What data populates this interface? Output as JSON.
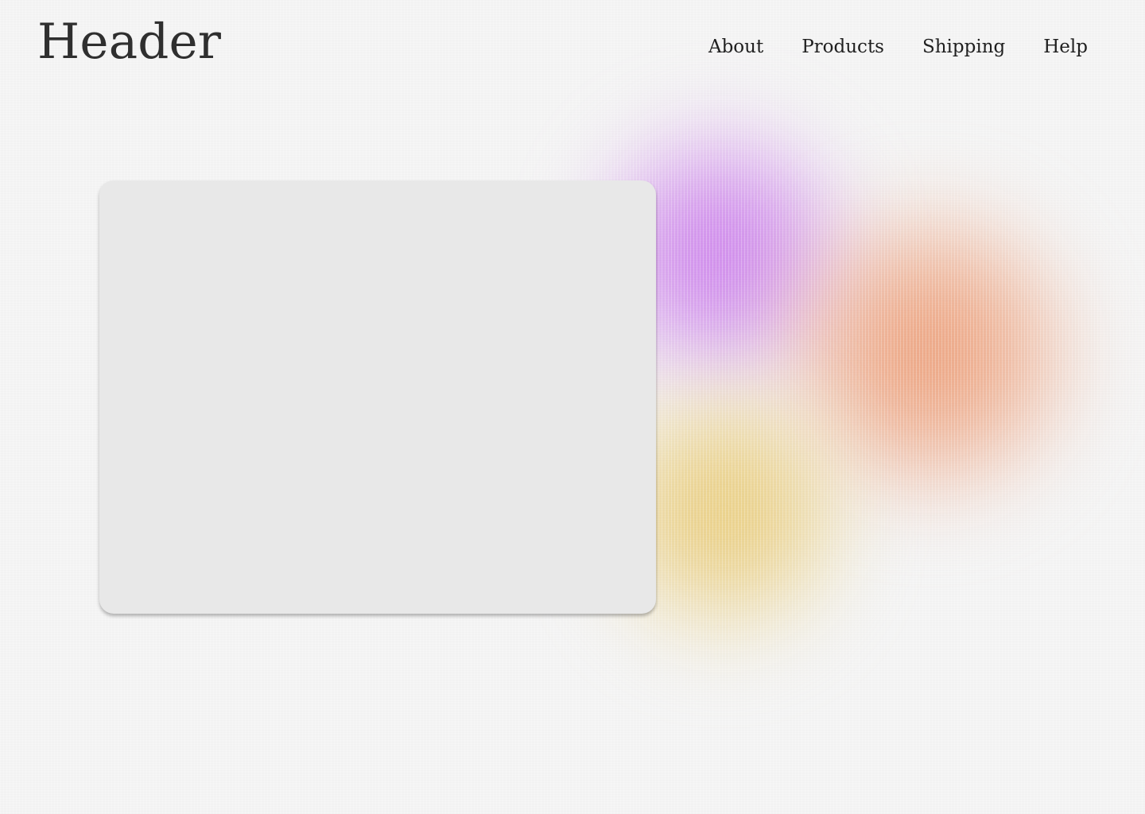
{
  "header": {
    "title": "Header",
    "nav": [
      {
        "label": "About"
      },
      {
        "label": "Products"
      },
      {
        "label": "Shipping"
      },
      {
        "label": "Help"
      }
    ]
  },
  "colors": {
    "background": "#f4f4f4",
    "card": "#e8e8e8",
    "purple_blob": "#c670eb",
    "orange_blob": "#ec976e",
    "yellow_blob": "#e7c464",
    "text": "#2f2f2f"
  }
}
